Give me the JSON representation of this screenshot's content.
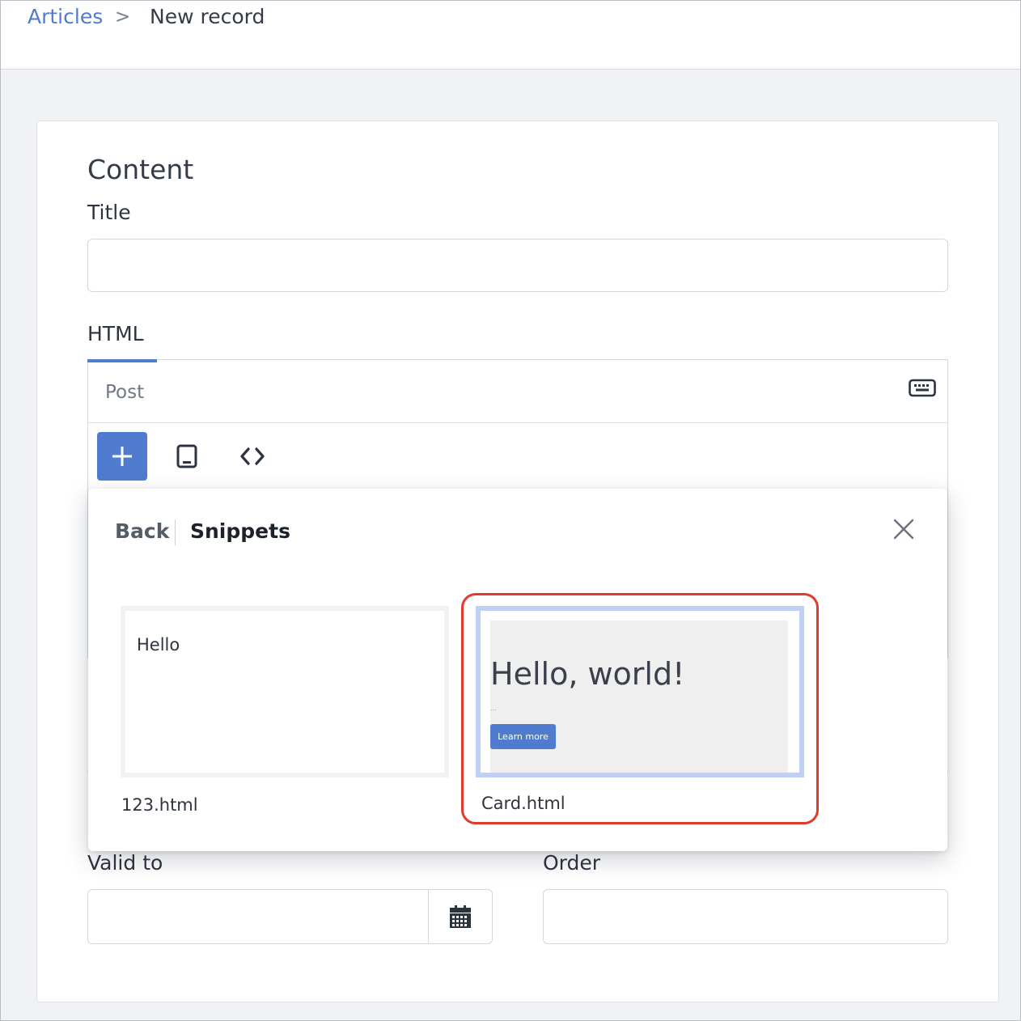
{
  "breadcrumb": {
    "parent": "Articles",
    "separator": ">",
    "current": "New record"
  },
  "form": {
    "section_title": "Content",
    "title_label": "Title",
    "title_value": "",
    "html_label": "HTML",
    "editor": {
      "header_label": "Post",
      "keyboard_icon": "keyboard-icon",
      "toolbar": [
        {
          "icon": "plus-icon",
          "active": true
        },
        {
          "icon": "tablet-icon",
          "active": false
        },
        {
          "icon": "code-icon",
          "active": false
        }
      ]
    },
    "valid_to_label": "Valid to",
    "valid_to_value": "",
    "calendar_icon": "calendar-icon",
    "order_label": "Order",
    "order_value": ""
  },
  "popover": {
    "back_label": "Back",
    "title": "Snippets",
    "close_icon": "close-icon",
    "snippets": [
      {
        "name": "123.html",
        "preview_text": "Hello",
        "selected": false
      },
      {
        "name": "Card.html",
        "preview_heading": "Hello, world!",
        "preview_dots": "...",
        "preview_button": "Learn more",
        "selected": true
      }
    ]
  },
  "colors": {
    "accent": "#4f7ccf",
    "highlight": "#e23a2a",
    "page_background": "#f0f2f6"
  }
}
